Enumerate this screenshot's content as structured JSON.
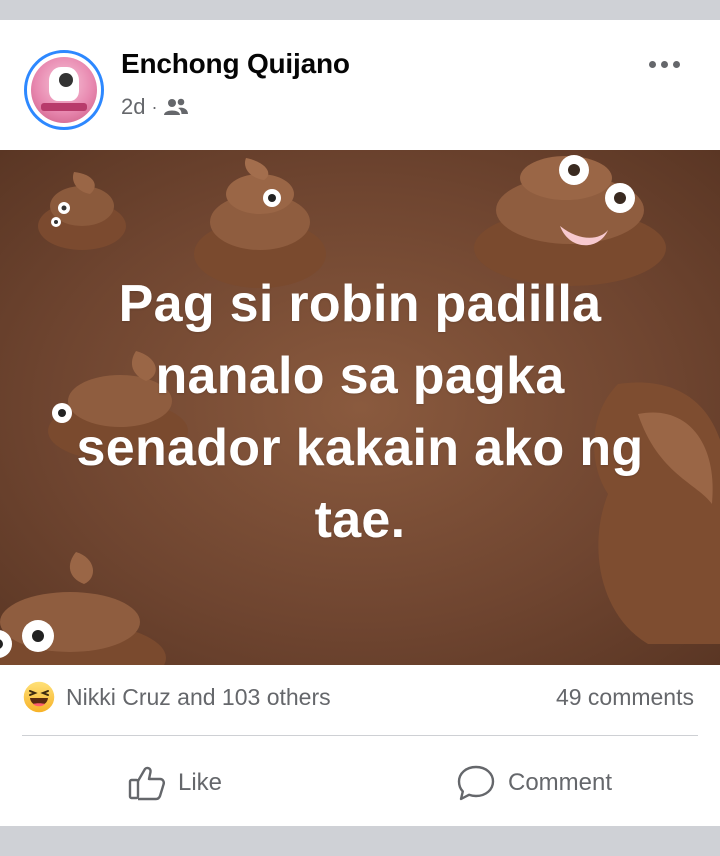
{
  "post": {
    "author": "Enchong Quijano",
    "time": "2d",
    "separator": "·",
    "audience_icon": "friends-icon",
    "more_icon": "more-options-icon",
    "image_text_lines": [
      "Pag si robin padilla",
      "nanalo sa pagka",
      "senador kakain ako ng",
      "tae."
    ]
  },
  "stats": {
    "reaction_icon": "haha-reaction-icon",
    "reactions_text": "Nikki Cruz and 103 others",
    "comments_text": "49 comments"
  },
  "actions": {
    "like_label": "Like",
    "comment_label": "Comment"
  },
  "colors": {
    "brand_blue": "#2d88ff",
    "secondary_text": "#65676b",
    "image_bg": "#6f4530",
    "poop_brown": "#8b5a3c"
  }
}
